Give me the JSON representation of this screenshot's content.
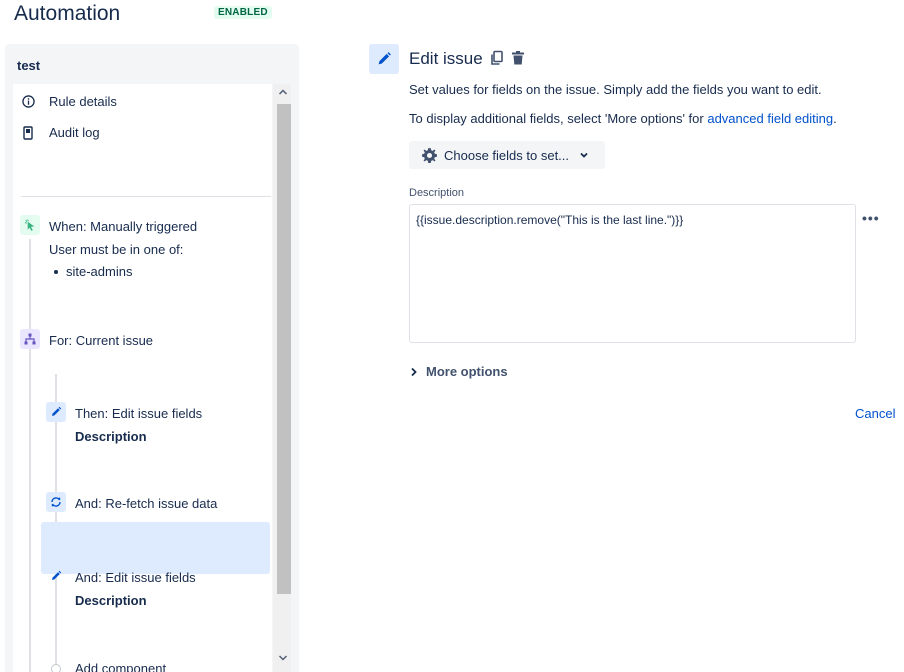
{
  "header": {
    "title": "Automation",
    "status": "ENABLED"
  },
  "sidebar": {
    "rule_name": "test",
    "menu": [
      {
        "label": "Rule details",
        "icon": "info-icon"
      },
      {
        "label": "Audit log",
        "icon": "document-icon"
      }
    ],
    "trigger": {
      "label": "When: Manually triggered",
      "sub_label": "User must be in one of:",
      "groups": [
        "site-admins"
      ],
      "icon": "cursor-click-icon",
      "color": "#36b37e"
    },
    "branch": {
      "label": "For: Current issue",
      "icon": "branch-icon",
      "color": "#6554c0"
    },
    "actions": [
      {
        "label": "Then: Edit issue fields",
        "detail": "Description",
        "icon": "pencil-icon"
      },
      {
        "label": "And: Re-fetch issue data",
        "detail": "",
        "icon": "refresh-icon"
      },
      {
        "label": "And: Edit issue fields",
        "detail": "Description",
        "icon": "pencil-icon",
        "selected": true
      }
    ],
    "add_component": "Add component"
  },
  "editor": {
    "title": "Edit issue",
    "description_line": "Set values for fields on the issue. Simply add the fields you want to edit.",
    "display_prefix": "To display additional fields, select 'More options' for ",
    "display_link": "advanced field editing",
    "display_suffix": ".",
    "choose_fields_label": "Choose fields to set...",
    "field_label": "Description",
    "field_value": "{{issue.description.remove(\"This is the last line.\")}}",
    "more_options_label": "More options",
    "cancel_label": "Cancel"
  },
  "colors": {
    "primary": "#0052cc",
    "selected_bg": "#deebff",
    "enabled_bg": "#e3fcef",
    "enabled_text": "#006644"
  }
}
